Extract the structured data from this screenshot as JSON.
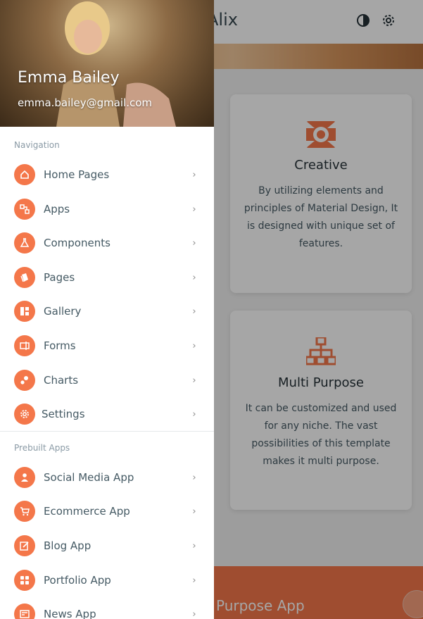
{
  "app": {
    "title": "Alix"
  },
  "toolbar": {
    "theme_icon": "contrast-icon",
    "settings_icon": "gear-icon"
  },
  "cards": [
    {
      "icon": "creative-icon",
      "title": "Creative",
      "text": "By utilizing elements and principles of Material Design, It is designed with unique set of features."
    },
    {
      "icon": "sitemap-icon",
      "title": "Multi Purpose",
      "text": "It can be customized and used for any niche. The vast possibilities of this template makes it multi purpose."
    }
  ],
  "banner": {
    "text": "Purpose App"
  },
  "drawer": {
    "user": {
      "name": "Emma Bailey",
      "email": "emma.bailey@gmail.com"
    },
    "navigation_label": "Navigation",
    "navigation": [
      {
        "label": "Home Pages",
        "icon": "home-icon"
      },
      {
        "label": "Apps",
        "icon": "apps-icon"
      },
      {
        "label": "Components",
        "icon": "flask-icon"
      },
      {
        "label": "Pages",
        "icon": "pages-icon"
      },
      {
        "label": "Gallery",
        "icon": "gallery-icon"
      },
      {
        "label": "Forms",
        "icon": "forms-icon"
      },
      {
        "label": "Charts",
        "icon": "charts-icon"
      },
      {
        "label": "Settings",
        "icon": "gear-icon"
      }
    ],
    "prebuilt_label": "Prebuilt Apps",
    "prebuilt": [
      {
        "label": "Social Media App",
        "icon": "person-icon"
      },
      {
        "label": "Ecommerce App",
        "icon": "cart-icon"
      },
      {
        "label": "Blog App",
        "icon": "edit-icon"
      },
      {
        "label": "Portfolio App",
        "icon": "portfolio-icon"
      },
      {
        "label": "News App",
        "icon": "news-icon"
      }
    ]
  },
  "colors": {
    "accent": "#f4774a",
    "text": "#455a64",
    "muted": "#8a9aa5"
  }
}
